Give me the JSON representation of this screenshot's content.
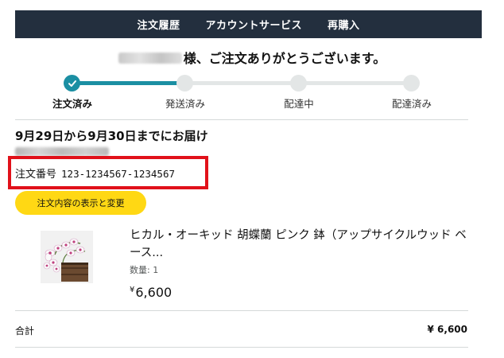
{
  "nav": {
    "items": [
      "注文履歴",
      "アカウントサービス",
      "再購入"
    ],
    "background": "#232f3e"
  },
  "greeting": "様、ご注文ありがとうございます。",
  "tracker": {
    "steps": [
      "注文済み",
      "発送済み",
      "配達中",
      "配達済み"
    ],
    "current_step": 1,
    "accent": "#1b8fa3"
  },
  "delivery": {
    "estimate": "9月29日から9月30日までにお届け"
  },
  "order": {
    "label": "注文番号",
    "number": "123-1234567-1234567",
    "highlight_color": "#e1111a"
  },
  "actions": {
    "view_change_label": "注文内容の表示と変更",
    "button_color": "#ffd814"
  },
  "item": {
    "title": "ヒカル・オーキッド 胡蝶蘭 ピンク 鉢（アップサイクルウッド ベース...",
    "quantity": "数量: 1",
    "price_symbol": "¥",
    "price": "6,600"
  },
  "summary": {
    "total_label": "合計",
    "total_value": "¥ 6,600"
  }
}
